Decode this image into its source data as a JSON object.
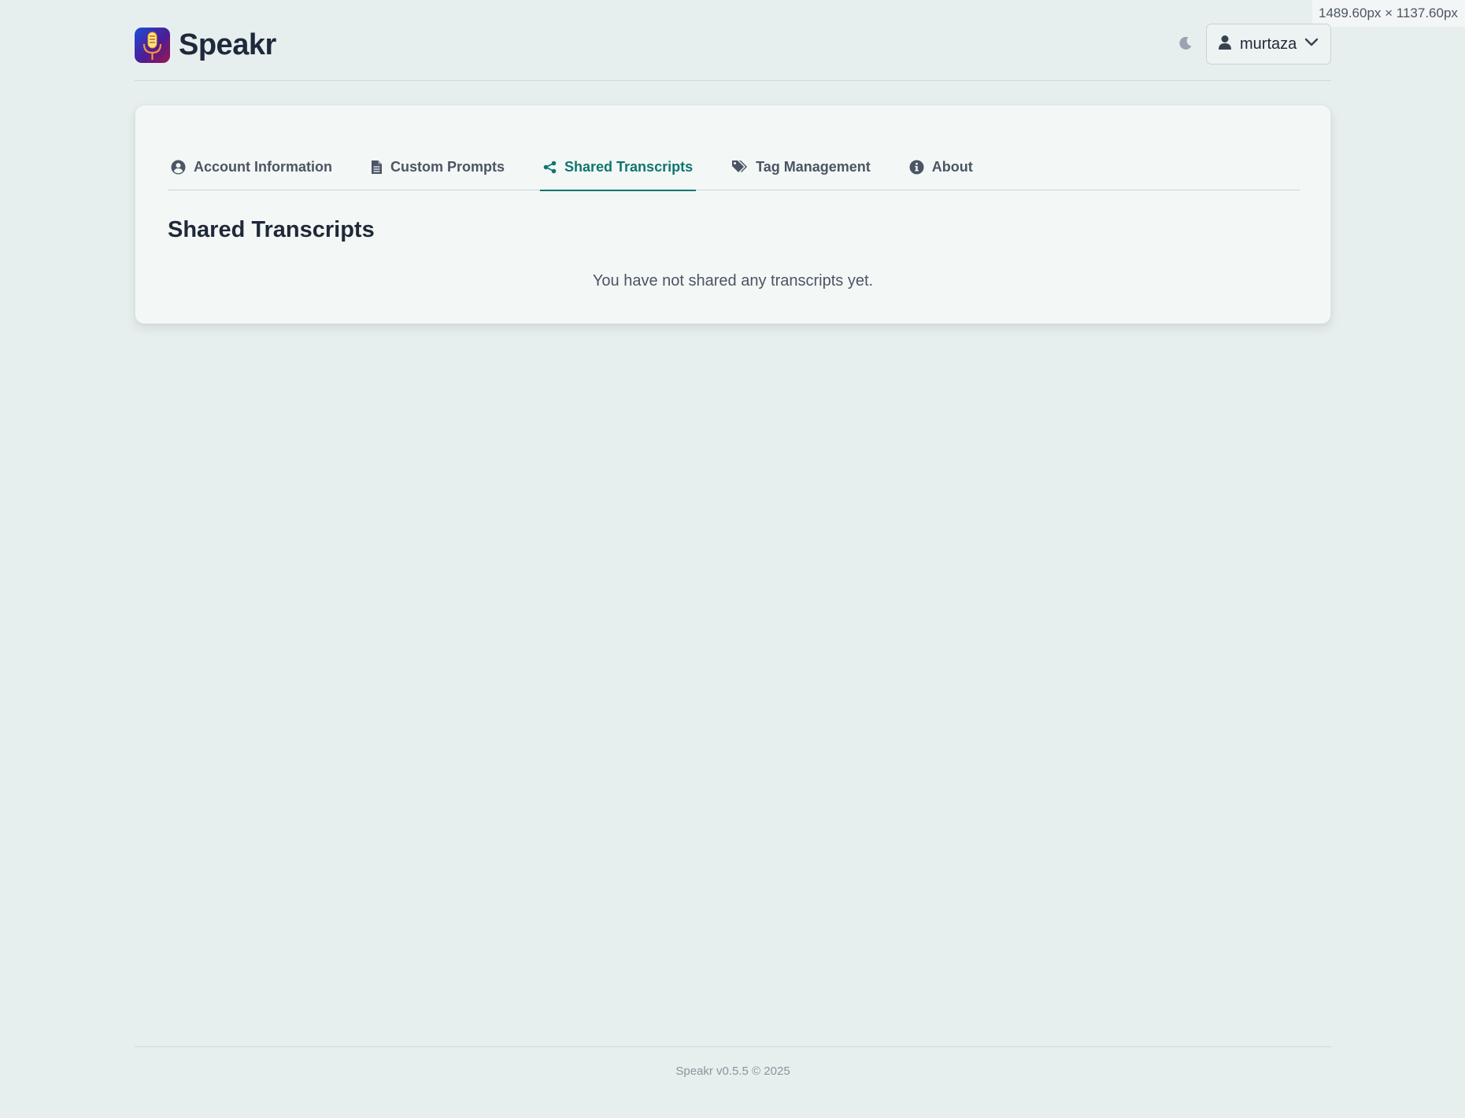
{
  "viewport_badge": "1489.60px × 1137.60px",
  "header": {
    "brand": "Speakr",
    "theme_icon": "moon-icon",
    "user": {
      "name": "murtaza",
      "icon": "user-icon",
      "chevron": "chevron-down-icon"
    }
  },
  "tabs": [
    {
      "label": "Account Information",
      "icon": "user-circle-icon",
      "active": false
    },
    {
      "label": "Custom Prompts",
      "icon": "file-icon",
      "active": false
    },
    {
      "label": "Shared Transcripts",
      "icon": "share-icon",
      "active": true
    },
    {
      "label": "Tag Management",
      "icon": "tags-icon",
      "active": false
    },
    {
      "label": "About",
      "icon": "info-icon",
      "active": false
    }
  ],
  "main": {
    "title": "Shared Transcripts",
    "empty_message": "You have not shared any transcripts yet."
  },
  "footer": {
    "text": "Speakr v0.5.5 © 2025"
  },
  "colors": {
    "accent": "#0f766e",
    "background": "#e7efee",
    "card": "#f3f7f6"
  }
}
